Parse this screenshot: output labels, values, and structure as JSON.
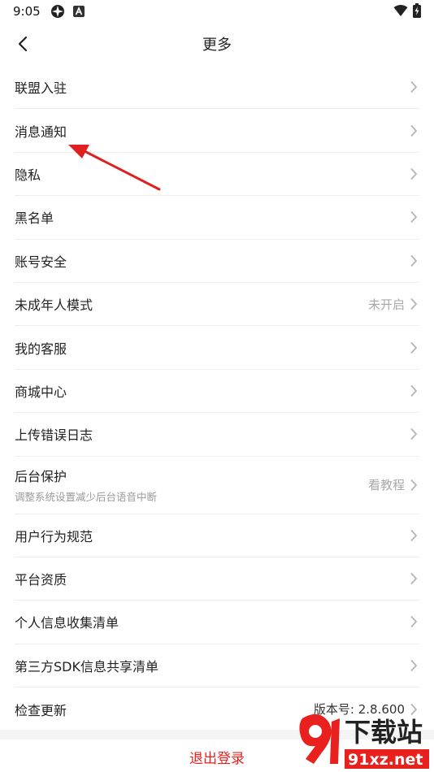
{
  "status_bar": {
    "time": "9:05"
  },
  "nav": {
    "title": "更多"
  },
  "rows": [
    {
      "label": "联盟入驻",
      "sub": "",
      "value": ""
    },
    {
      "label": "消息通知",
      "sub": "",
      "value": ""
    },
    {
      "label": "隐私",
      "sub": "",
      "value": ""
    },
    {
      "label": "黑名单",
      "sub": "",
      "value": ""
    },
    {
      "label": "账号安全",
      "sub": "",
      "value": ""
    },
    {
      "label": "未成年人模式",
      "sub": "",
      "value": "未开启"
    },
    {
      "label": "我的客服",
      "sub": "",
      "value": ""
    },
    {
      "label": "商城中心",
      "sub": "",
      "value": ""
    },
    {
      "label": "上传错误日志",
      "sub": "",
      "value": ""
    },
    {
      "label": "后台保护",
      "sub": "调整系统设置减少后台语音中断",
      "value": "看教程"
    },
    {
      "label": "用户行为规范",
      "sub": "",
      "value": ""
    },
    {
      "label": "平台资质",
      "sub": "",
      "value": ""
    },
    {
      "label": "个人信息收集清单",
      "sub": "",
      "value": ""
    },
    {
      "label": "第三方SDK信息共享清单",
      "sub": "",
      "value": ""
    },
    {
      "label": "检查更新",
      "sub": "",
      "value": "版本号: 2.8.600"
    }
  ],
  "logout": {
    "label": "退出登录"
  },
  "watermark": {
    "main": "下载站",
    "url": "91xz.net"
  },
  "colors": {
    "accent": "#e8211e",
    "divider": "#eeeeee",
    "muted": "#a8a8a8",
    "annotation": "#e02020"
  },
  "icons": {
    "back": "chevron-left-icon",
    "row_arrow": "chevron-right-icon",
    "status": [
      "snowflake-icon",
      "app-a-icon",
      "wifi-icon",
      "battery-charging-icon"
    ]
  }
}
